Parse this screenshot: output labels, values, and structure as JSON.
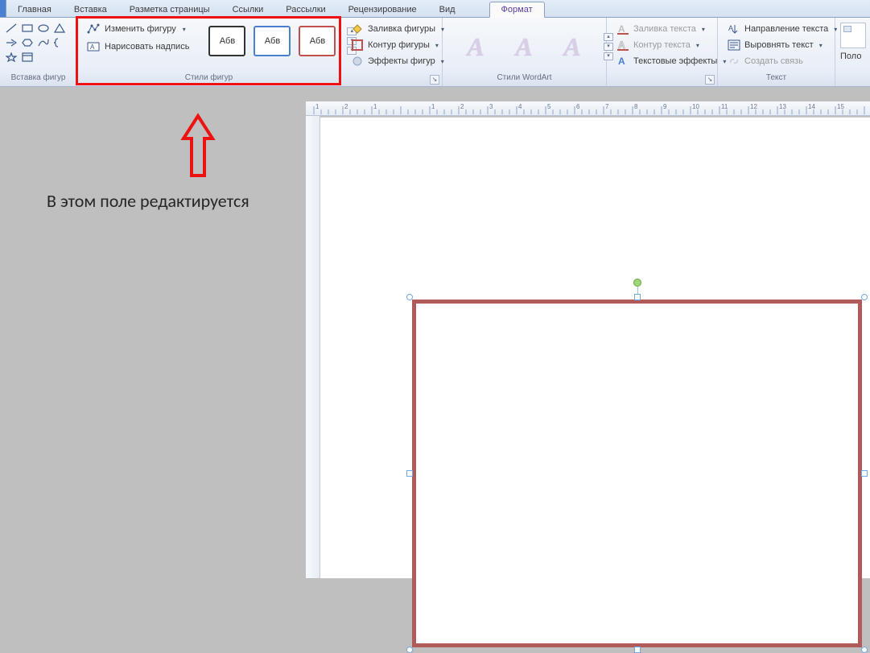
{
  "tabs": {
    "items": [
      "Главная",
      "Вставка",
      "Разметка страницы",
      "Ссылки",
      "Рассылки",
      "Рецензирование",
      "Вид"
    ],
    "context": "Формат"
  },
  "ribbon": {
    "insertShapes": {
      "label": "Вставка фигур"
    },
    "editShape": {
      "edit": "Изменить фигуру",
      "textbox": "Нарисовать надпись"
    },
    "shapeStyles": {
      "label": "Стили фигур",
      "sample": "Абв",
      "fill": "Заливка фигуры",
      "outline": "Контур фигуры",
      "effects": "Эффекты фигур"
    },
    "wordart": {
      "label": "Стили WordArt",
      "letter": "А",
      "fill": "Заливка текста",
      "outline": "Контур текста",
      "effects": "Текстовые эффекты"
    },
    "text": {
      "label": "Текст",
      "direction": "Направление текста",
      "align": "Выровнять текст",
      "link": "Создать связь"
    },
    "position": {
      "label": "Поло"
    }
  },
  "annotation": "В этом поле редактируется",
  "ruler": {
    "numbers": [
      "1",
      "2",
      "1",
      "",
      "1",
      "2",
      "3",
      "4",
      "5",
      "6",
      "7",
      "8",
      "9",
      "10",
      "11",
      "12",
      "13",
      "14",
      "15"
    ]
  },
  "shape": {
    "borderColor": "#b05a5a"
  }
}
